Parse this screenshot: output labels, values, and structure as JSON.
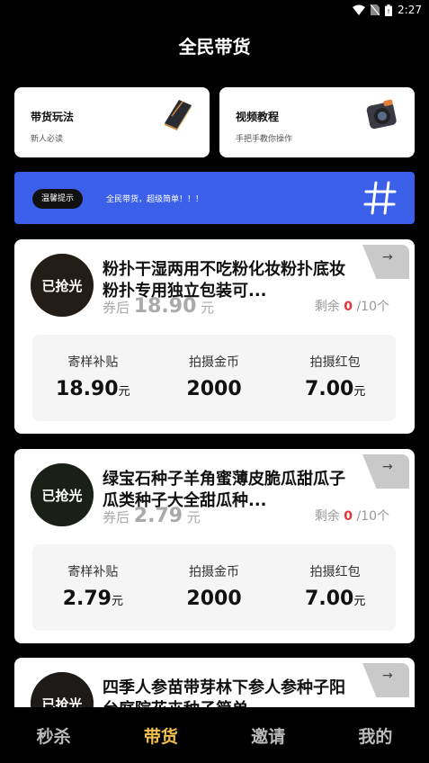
{
  "status": {
    "time": "2:27"
  },
  "header": {
    "title": "全民带货"
  },
  "top_cards": [
    {
      "title": "带货玩法",
      "subtitle": "新人必读",
      "icon": "book-icon"
    },
    {
      "title": "视频教程",
      "subtitle": "手把手教你操作",
      "icon": "camera-icon"
    }
  ],
  "banner": {
    "tag": "温馨提示",
    "text": "全民带货，超级简单！！！",
    "icon": "hash-icon",
    "color": "#3b5fe8"
  },
  "products": [
    {
      "name": "粉扑干湿两用不吃粉化妆粉扑底妆粉扑专用独立包装可...",
      "badge": "已抢光",
      "after_label": "券后",
      "after_price": "18.90",
      "after_unit": "元",
      "remain_label": "剩余",
      "remain_count": "0",
      "remain_total": "/10个",
      "stat1_label": "寄样补贴",
      "stat1_value": "18.90",
      "stat1_unit": "元",
      "stat2_label": "拍摄金币",
      "stat2_value": "2000",
      "stat3_label": "拍摄红包",
      "stat3_value": "7.00",
      "stat3_unit": "元"
    },
    {
      "name": "绿宝石种子羊角蜜薄皮脆瓜甜瓜子瓜类种子大全甜瓜种...",
      "badge": "已抢光",
      "after_label": "券后",
      "after_price": "2.79",
      "after_unit": "元",
      "remain_label": "剩余",
      "remain_count": "0",
      "remain_total": "/10个",
      "stat1_label": "寄样补贴",
      "stat1_value": "2.79",
      "stat1_unit": "元",
      "stat2_label": "拍摄金币",
      "stat2_value": "2000",
      "stat3_label": "拍摄红包",
      "stat3_value": "7.00",
      "stat3_unit": "元"
    },
    {
      "name": "四季人参苗带芽林下参人参种子阳台庭院花卉种子简单...",
      "badge": "已抢光"
    }
  ],
  "nav": {
    "items": [
      "秒杀",
      "带货",
      "邀请",
      "我的"
    ],
    "active": "带货",
    "active_color": "#f2c14e"
  }
}
